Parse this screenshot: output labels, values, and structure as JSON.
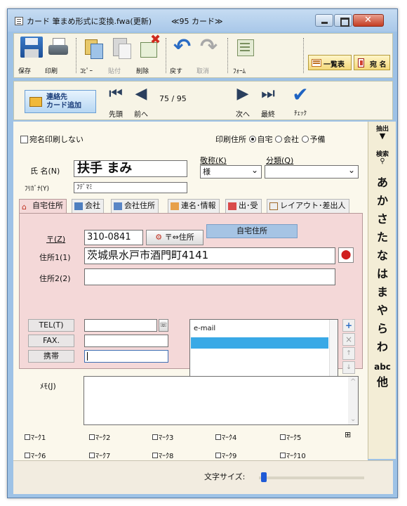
{
  "window": {
    "title": "カード 筆まめ形式に変換.fwa(更新)",
    "count": "≪95 カード≫"
  },
  "toolbar": {
    "save": "保存",
    "print": "印刷",
    "copy": "ｺﾋﾟｰ",
    "paste": "貼付",
    "delete": "削除",
    "undo": "戻す",
    "redo": "取消",
    "form": "ﾌｫｰﾑ",
    "list": "一覧表",
    "name": "宛 名"
  },
  "nav": {
    "add_line1": "連絡先",
    "add_line2": "カード追加",
    "first": "先頭",
    "prev": "前へ",
    "current": "75",
    "sep": "/",
    "total": "95",
    "next": "次へ",
    "last": "最終",
    "check": "ﾁｪｯｸ"
  },
  "sidebar": {
    "extract": "抽出",
    "search": "検索",
    "kana": [
      "あ",
      "か",
      "さ",
      "た",
      "な",
      "は",
      "ま",
      "や",
      "ら",
      "わ"
    ],
    "abc": "abc",
    "other": "他"
  },
  "form": {
    "no_print": "宛名印刷しない",
    "print_addr": "印刷住所",
    "addr_options": [
      "自宅",
      "会社",
      "予備"
    ],
    "name_label": "氏 名(N)",
    "name_value": "扶手 まみ",
    "kana_label": "ﾌﾘｶﾞﾅ(Y)",
    "kana_value": "ﾌﾃﾞﾏﾐ",
    "title_label": "敬称(K)",
    "title_value": "様",
    "cat_label": "分類(Q)",
    "cat_value": ""
  },
  "tabs": [
    "自宅住所",
    "会社",
    "会社住所",
    "連名･情報",
    "出･受",
    "レイアウト･差出人"
  ],
  "address": {
    "zip_label": "〒(Z)",
    "zip_value": "310-0841",
    "zip_btn": "〒⇔住所",
    "badge": "自宅住所",
    "addr1_label": "住所1(1)",
    "addr1_value": "茨城県水戸市酒門町4141",
    "addr2_label": "住所2(2)",
    "addr2_value": "",
    "tel_label": "TEL(T)",
    "fax_label": "FAX.",
    "mobile_label": "携帯",
    "email_label": "e-mail"
  },
  "memo_label": "ﾒﾓ(J)",
  "marks": [
    "ﾏｰｸ1",
    "ﾏｰｸ2",
    "ﾏｰｸ3",
    "ﾏｰｸ4",
    "ﾏｰｸ5",
    "ﾏｰｸ6",
    "ﾏｰｸ7",
    "ﾏｰｸ8",
    "ﾏｰｸ9",
    "ﾏｰｸ10"
  ],
  "font_size_label": "文字サイズ:",
  "font_size_level": 0.02
}
